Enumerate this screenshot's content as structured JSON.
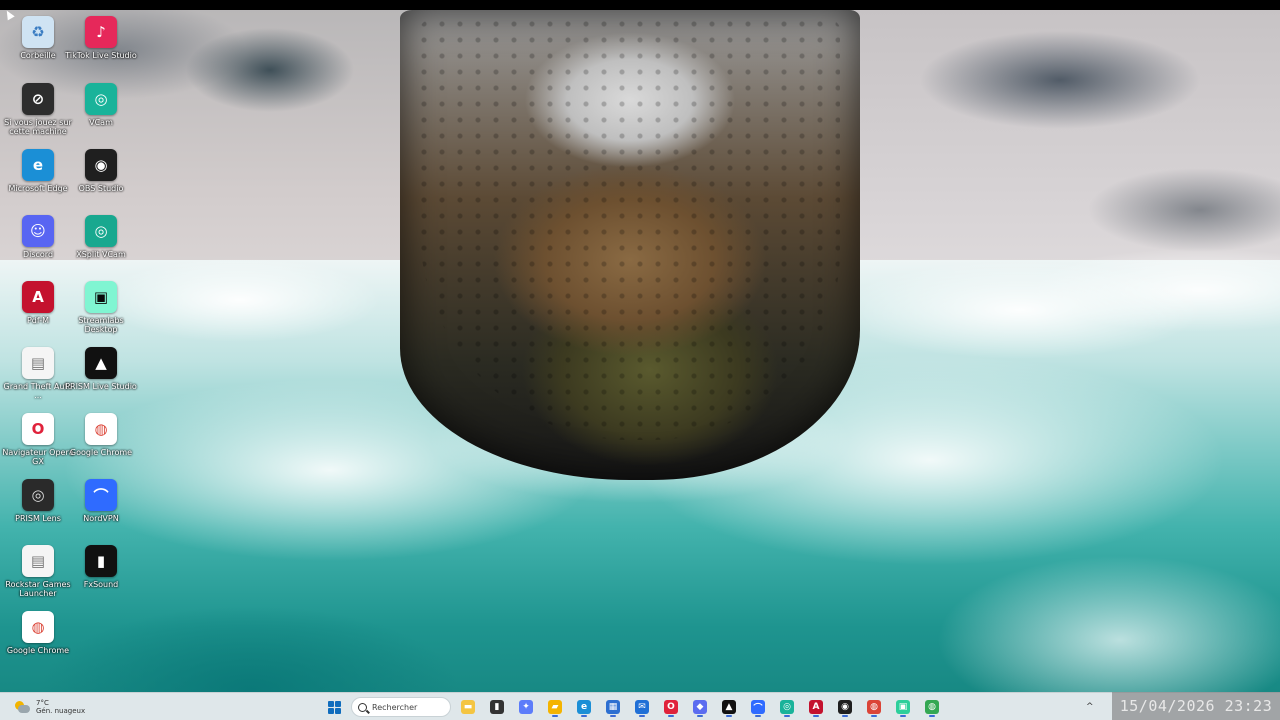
{
  "desktop_icons": [
    {
      "id": "corbeille",
      "label": "Corbeille",
      "icon": "recycle-bin-icon",
      "bg": "#cfe3f3",
      "fg": "#3a7cc2",
      "glyph": "♻"
    },
    {
      "id": "tiktok",
      "label": "TikTok Live Studio",
      "icon": "tiktok-live-studio-icon",
      "bg": "#e6285a",
      "fg": "#ffffff",
      "glyph": "♪"
    },
    {
      "id": "faceit",
      "label": "Si vous jouez sur cette machine",
      "icon": "faceit-icon",
      "bg": "#2d2d2d",
      "fg": "#ffffff",
      "glyph": "⊘"
    },
    {
      "id": "vcam",
      "label": "VCam",
      "icon": "vcam-icon",
      "bg": "#19b39a",
      "fg": "#ffffff",
      "glyph": "◎"
    },
    {
      "id": "edge",
      "label": "Microsoft Edge",
      "icon": "microsoft-edge-icon",
      "bg": "#1b8fd6",
      "fg": "#ffffff",
      "glyph": "e"
    },
    {
      "id": "obs",
      "label": "OBS Studio",
      "icon": "obs-studio-icon",
      "bg": "#1f1f1f",
      "fg": "#ffffff",
      "glyph": "◉"
    },
    {
      "id": "discord",
      "label": "Discord",
      "icon": "discord-icon",
      "bg": "#5865f2",
      "fg": "#ffffff",
      "glyph": "☺"
    },
    {
      "id": "xsplit",
      "label": "XSplit VCam",
      "icon": "xsplit-vcam-icon",
      "bg": "#18a88f",
      "fg": "#ffffff",
      "glyph": "◎"
    },
    {
      "id": "pdf",
      "label": "Pdf-M",
      "icon": "pdf-app-icon",
      "bg": "#c4122e",
      "fg": "#ffffff",
      "glyph": "A"
    },
    {
      "id": "streamlabs",
      "label": "Streamlabs Desktop",
      "icon": "streamlabs-icon",
      "bg": "#80f5d2",
      "fg": "#0a0a0a",
      "glyph": "▣"
    },
    {
      "id": "gta",
      "label": "Grand Theft Auto ...",
      "icon": "document-icon",
      "bg": "#f5f5f5",
      "fg": "#777777",
      "glyph": "▤"
    },
    {
      "id": "prism",
      "label": "PRISM Live Studio",
      "icon": "prism-live-studio-icon",
      "bg": "#111111",
      "fg": "#ffffff",
      "glyph": "▲"
    },
    {
      "id": "opera",
      "label": "Navigateur Opera GX",
      "icon": "opera-gx-icon",
      "bg": "#ffffff",
      "fg": "#e0223b",
      "glyph": "O"
    },
    {
      "id": "chrome",
      "label": "Google Chrome",
      "icon": "google-chrome-icon",
      "bg": "#ffffff",
      "fg": "#db4437",
      "glyph": "◍"
    },
    {
      "id": "prismlens",
      "label": "PRISM Lens",
      "icon": "prism-lens-icon",
      "bg": "#2a2a2a",
      "fg": "#dddddd",
      "glyph": "◎"
    },
    {
      "id": "nordvpn",
      "label": "NordVPN",
      "icon": "nordvpn-icon",
      "bg": "#2f6bff",
      "fg": "#ffffff",
      "glyph": "⌒"
    },
    {
      "id": "rockstar",
      "label": "Rockstar Games Launcher",
      "icon": "document-icon",
      "bg": "#f5f5f5",
      "fg": "#777777",
      "glyph": "▤"
    },
    {
      "id": "fxsound",
      "label": "FxSound",
      "icon": "fxsound-icon",
      "bg": "#111111",
      "fg": "#ffffff",
      "glyph": "▮"
    },
    {
      "id": "chrome2",
      "label": "Google Chrome",
      "icon": "google-chrome-icon",
      "bg": "#ffffff",
      "fg": "#db4437",
      "glyph": "◍"
    }
  ],
  "taskbar": {
    "weather": {
      "temp": "7°C",
      "condition": "Gén. nuageux",
      "icon": "partly-cloudy-icon"
    },
    "search_placeholder": "Rechercher",
    "apps": [
      {
        "name": "file-explorer",
        "icon": "folder-icon",
        "bg": "#f4c542",
        "glyph": "▬"
      },
      {
        "name": "task-view",
        "icon": "task-view-icon",
        "bg": "#333333",
        "glyph": "▮"
      },
      {
        "name": "copilot",
        "icon": "copilot-icon",
        "bg": "#5c7cfa",
        "glyph": "✦"
      },
      {
        "name": "explorer",
        "icon": "folder-icon",
        "bg": "#f4b400",
        "glyph": "▰"
      },
      {
        "name": "edge",
        "icon": "microsoft-edge-icon",
        "bg": "#1b8fd6",
        "glyph": "e"
      },
      {
        "name": "store",
        "icon": "microsoft-store-icon",
        "bg": "#2c6fd1",
        "glyph": "▦"
      },
      {
        "name": "mail",
        "icon": "mail-icon",
        "bg": "#1f6fd6",
        "glyph": "✉"
      },
      {
        "name": "opera",
        "icon": "opera-gx-icon",
        "bg": "#e0223b",
        "glyph": "O"
      },
      {
        "name": "app-badge",
        "icon": "app-icon",
        "bg": "#5b6cf0",
        "glyph": "◆"
      },
      {
        "name": "prism",
        "icon": "prism-live-studio-icon",
        "bg": "#111111",
        "glyph": "▲"
      },
      {
        "name": "nordvpn",
        "icon": "nordvpn-icon",
        "bg": "#2f6bff",
        "glyph": "⌒"
      },
      {
        "name": "vcam",
        "icon": "vcam-icon",
        "bg": "#19b39a",
        "glyph": "◎"
      },
      {
        "name": "pdf",
        "icon": "pdf-app-icon",
        "bg": "#c4122e",
        "glyph": "A"
      },
      {
        "name": "obs",
        "icon": "obs-studio-icon",
        "bg": "#1f1f1f",
        "glyph": "◉"
      },
      {
        "name": "chrome",
        "icon": "google-chrome-icon",
        "bg": "#db4437",
        "glyph": "◍"
      },
      {
        "name": "streamlabs",
        "icon": "streamlabs-icon",
        "bg": "#2ccf9b",
        "glyph": "▣"
      },
      {
        "name": "chrome-profile",
        "icon": "google-chrome-icon",
        "bg": "#34a853",
        "glyph": "◍"
      }
    ],
    "datetime_overlay": "15/04/2026 23:23"
  }
}
